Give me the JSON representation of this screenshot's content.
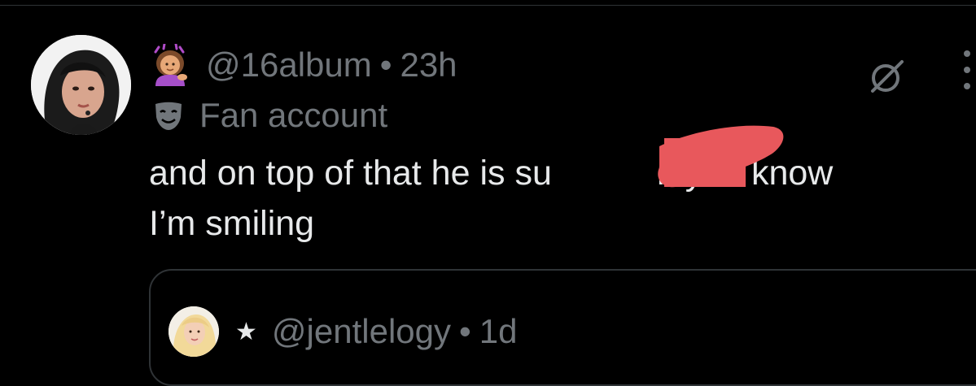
{
  "tweet": {
    "author_handle": "@16album",
    "separator": "•",
    "time_ago": "23h",
    "label": "Fan account",
    "text_line_1": "and on top of that he is su",
    "text_line_1_end": "ı. you know",
    "text_line_2": "I’m smiling"
  },
  "quoted_tweet": {
    "star": "★",
    "author_handle": "@jentlelogy",
    "separator": "•",
    "time_ago": "1d"
  },
  "icons": {
    "author_emoji": "woman-tipping-hand-emoji-icon",
    "label_icon": "theater-mask-icon",
    "grok": "grok-icon",
    "more": "more-vertical-icon"
  },
  "colors": {
    "background": "#000000",
    "text_primary": "#e7e9ea",
    "text_secondary": "#71767b",
    "border": "#2f3336",
    "redaction": "#e8585c"
  }
}
